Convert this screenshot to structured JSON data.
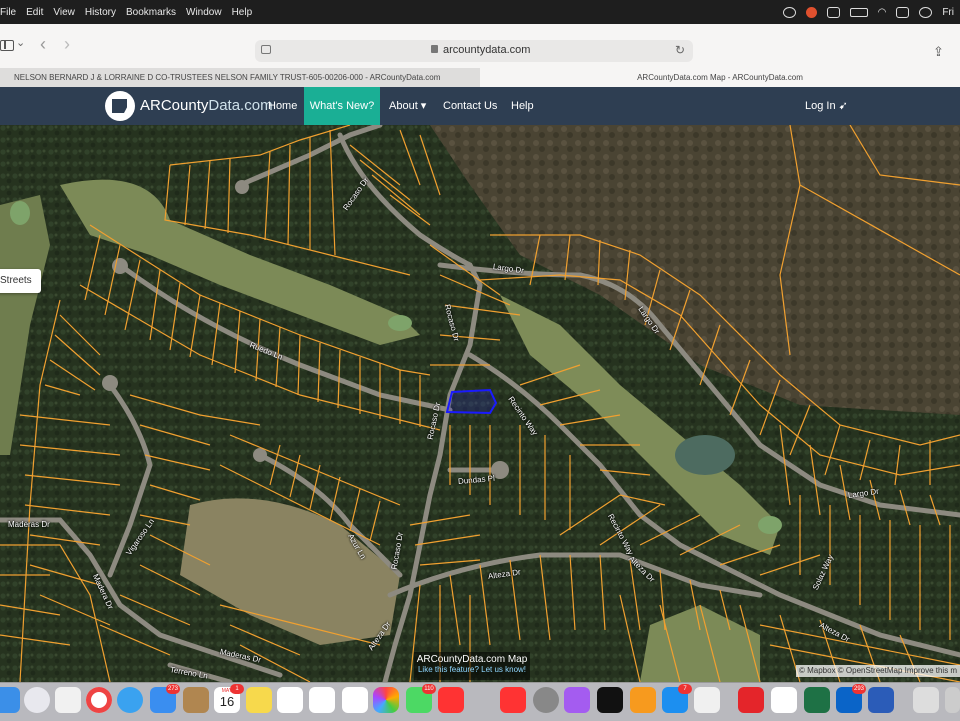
{
  "menubar": {
    "apple": "File",
    "items": [
      "Edit",
      "View",
      "History",
      "Bookmarks",
      "Window",
      "Help"
    ],
    "clock": "Fri"
  },
  "browser": {
    "url": "arcountydata.com",
    "tabs": [
      "NELSON BERNARD J & LORRAINE D CO-TRUSTEES NELSON FAMILY TRUST-605-00206-000 - ARCountyData.com",
      "ARCountyData.com Map - ARCountyData.com"
    ]
  },
  "site": {
    "logo_part1": "ARCounty",
    "logo_part2": "Data.com",
    "nav": {
      "home": "Home",
      "whats_new": "What's New?",
      "about": "About ▾",
      "contact": "Contact Us",
      "help": "Help",
      "login": "Log In ➹"
    }
  },
  "map": {
    "layer_button": "Streets",
    "roads": {
      "rocaso_top": "Rocaso Dr",
      "largo_top": "Largo Dr",
      "largo_right": "Largo Dr",
      "rocaso_mid": "Rocaso Dr",
      "ruedo": "Ruedo Ln",
      "recinto": "Recinto Way",
      "rocaso_low": "Rocaso Dr",
      "dundas": "Dundas Pl",
      "largo_east": "Largo Dr",
      "maderas_w": "Maderas Dr",
      "vigaroso": "Vigaroso Ln",
      "madera_s": "Madera Dr",
      "azur": "Azur Ln",
      "rocaso_s": "Rocaso Dr",
      "altezza_c": "Alteza Dr",
      "recinto_e": "Recinto Way",
      "altezza_e": "Alteza Dr",
      "solaz": "Solaz Way",
      "alteza_far": "Alteza Dr",
      "alteza_sw": "Alteza Dr",
      "terreno": "Terreno Ln",
      "maderas_s": "Maderas Dr"
    },
    "attribution": "© Mapbox © OpenStreetMap  Improve this m",
    "caption_title": "ARCountyData.com Map",
    "caption_link": "Like this feature? Let us know!",
    "colors": {
      "parcel_line": "#f0a030",
      "selected_parcel": "#1a1aff",
      "forest": "#2b3a22",
      "golf": "#7a8a55"
    }
  },
  "dock": {
    "badges": {
      "mail": "273",
      "calendar_month": "MAY",
      "calendar_day": "16",
      "cal_badge": "1",
      "messages": "110",
      "appstore": "7",
      "acrobat": "",
      "outlook": "293"
    },
    "icons": [
      "finder-icon",
      "launchpad-icon",
      "apps-icon",
      "chrome-icon",
      "safari-icon",
      "mail-icon",
      "notes-icon",
      "calendar-icon",
      "stickies-icon",
      "freeform-icon",
      "reminders-icon",
      "photos-icon",
      "messages-icon",
      "news-icon",
      "music-icon",
      "settings-icon",
      "podcasts-icon",
      "tv-icon",
      "books-icon",
      "appstore-icon",
      "phone-icon",
      "acrobat-icon",
      "acrobat2-icon",
      "excel-icon",
      "outlook-icon",
      "word-icon",
      "preview-icon"
    ]
  }
}
